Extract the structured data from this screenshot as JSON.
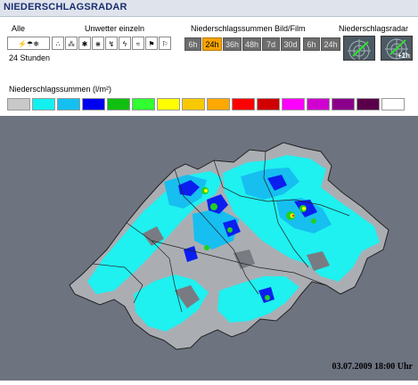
{
  "header": {
    "title": "NIEDERSCHLAGSRADAR"
  },
  "controls": {
    "all_label": "Alle",
    "storm_label": "Unwetter einzeln",
    "sum_label": "Niederschlagssummen Bild/Film",
    "radar_label": "Niederschlagsradar",
    "period_label": "24 Stunden",
    "durations_image": [
      "6h",
      "24h",
      "36h",
      "48h",
      "7d",
      "30d"
    ],
    "durations_film": [
      "6h",
      "24h"
    ],
    "selected_duration": "24h",
    "plus_label": "+1h"
  },
  "legend": {
    "title": "Niederschlagssummen (l/m²)",
    "colors": [
      "#c8c8c8",
      "#14f0f0",
      "#14c0f0",
      "#0000f0",
      "#10c010",
      "#30ff30",
      "#ffff00",
      "#f8c800",
      "#ffa800",
      "#ff0000",
      "#d00000",
      "#ff00ff",
      "#d000d0",
      "#8b008b",
      "#5a004a",
      "#ffffff"
    ]
  },
  "map": {
    "timestamp": "03.07.2009 18:00 Uhr",
    "background_color": "#6e7380"
  }
}
